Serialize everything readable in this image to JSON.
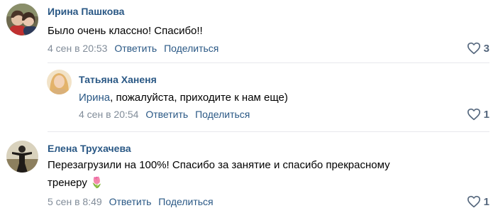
{
  "comments": [
    {
      "author": "Ирина Пашкова",
      "text": "Было очень классно! Спасибо!!",
      "date": "4 сен в 20:53",
      "reply_label": "Ответить",
      "share_label": "Поделиться",
      "likes": "3",
      "avatar_icon": "user-avatar-photo"
    },
    {
      "author": "Татьяна Ханеня",
      "reply_to": "Ирина",
      "text_rest": ", пожалуйста, приходите к нам еще)",
      "date": "4 сен в 20:54",
      "reply_label": "Ответить",
      "share_label": "Поделиться",
      "likes": "1",
      "avatar_icon": "user-avatar-photo"
    },
    {
      "author": "Елена Трухачева",
      "text_line1": "Перезагрузили на 100%! Спасибо за занятие и спасибо прекрасному",
      "text_line2": "тренеру",
      "emoji": "🌷",
      "date": "5 сен в 8:49",
      "reply_label": "Ответить",
      "share_label": "Поделиться",
      "likes": "1",
      "avatar_icon": "user-avatar-photo"
    }
  ],
  "colors": {
    "link": "#2a5885",
    "meta": "#818c99",
    "like": "#55677d",
    "divider": "#e7e8ec"
  }
}
